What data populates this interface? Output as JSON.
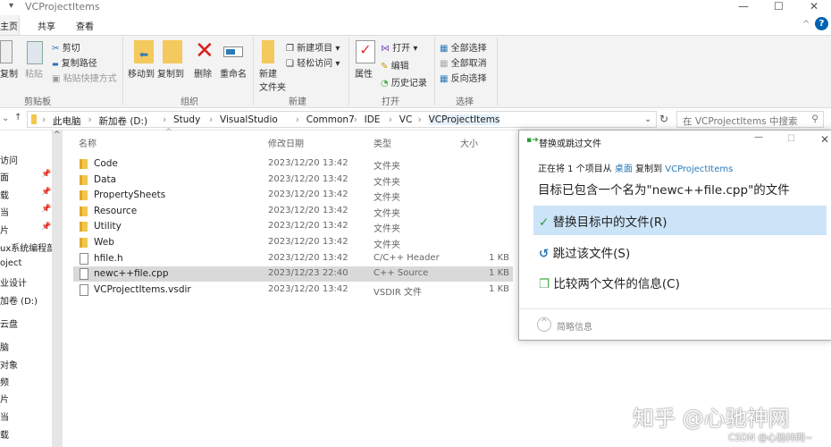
{
  "window": {
    "title": "VCProjectItems",
    "minimize": "—",
    "maximize": "☐",
    "close": "✕"
  },
  "tabs": [
    "主页",
    "共享",
    "查看"
  ],
  "ribbon": {
    "clipboard": {
      "copy": "复制",
      "paste": "粘贴",
      "cut": "剪切",
      "copy_path": "复制路径",
      "paste_shortcut": "粘贴快捷方式",
      "group": "剪贴板"
    },
    "organize": {
      "move_to": "移动到",
      "copy_to": "复制到",
      "delete": "删除",
      "rename": "重命名",
      "group": "组织"
    },
    "new": {
      "new_folder_1": "新建",
      "new_folder_2": "文件夹",
      "new_item": "新建项目",
      "easy_access": "轻松访问",
      "group": "新建"
    },
    "open": {
      "properties": "属性",
      "open": "打开",
      "edit": "编辑",
      "history": "历史记录",
      "group": "打开"
    },
    "select": {
      "select_all": "全部选择",
      "select_none": "全部取消",
      "invert": "反向选择",
      "group": "选择"
    }
  },
  "address": {
    "crumbs": [
      "此电脑",
      "新加卷 (D:)",
      "Study",
      "VisualStudio",
      "Common7",
      "IDE",
      "VC",
      "VCProjectItems"
    ],
    "search_placeholder": "在 VCProjectItems 中搜索"
  },
  "sidebar": [
    "访问",
    "面",
    "载",
    "当",
    "片",
    "ux系统编程部",
    "oject",
    "业设计",
    "加卷 (D:)",
    "云盘",
    "脑",
    "对象",
    "频",
    "片",
    "当",
    "载"
  ],
  "columns": {
    "name": "名称",
    "date": "修改日期",
    "type": "类型",
    "size": "大小"
  },
  "files": [
    {
      "name": "Code",
      "date": "2023/12/20 13:42",
      "type": "文件夹",
      "size": "",
      "kind": "folder"
    },
    {
      "name": "Data",
      "date": "2023/12/20 13:42",
      "type": "文件夹",
      "size": "",
      "kind": "folder"
    },
    {
      "name": "PropertySheets",
      "date": "2023/12/20 13:42",
      "type": "文件夹",
      "size": "",
      "kind": "folder"
    },
    {
      "name": "Resource",
      "date": "2023/12/20 13:42",
      "type": "文件夹",
      "size": "",
      "kind": "folder"
    },
    {
      "name": "Utility",
      "date": "2023/12/20 13:42",
      "type": "文件夹",
      "size": "",
      "kind": "folder"
    },
    {
      "name": "Web",
      "date": "2023/12/20 13:42",
      "type": "文件夹",
      "size": "",
      "kind": "folder"
    },
    {
      "name": "hfile.h",
      "date": "2023/12/20 13:42",
      "type": "C/C++ Header",
      "size": "1 KB",
      "kind": "file"
    },
    {
      "name": "newc++file.cpp",
      "date": "2023/12/23 22:40",
      "type": "C++ Source",
      "size": "1 KB",
      "kind": "file"
    },
    {
      "name": "VCProjectItems.vsdir",
      "date": "2023/12/20 13:42",
      "type": "VSDIR 文件",
      "size": "1 KB",
      "kind": "file"
    }
  ],
  "dialog": {
    "title": "替换或跳过文件",
    "copy_prefix": "正在将 1 个项目从",
    "source": "桌面",
    "copy_mid": "复制到",
    "dest": "VCProjectItems",
    "message": "目标已包含一个名为\"newc++file.cpp\"的文件",
    "replace": "替换目标中的文件(R)",
    "skip": "跳过该文件(S)",
    "compare": "比较两个文件的信息(C)",
    "details": "简略信息"
  },
  "watermark": {
    "zhihu": "知乎 @心驰神网",
    "csdn": "CSDN @心驰神网~"
  },
  "colors": {
    "accent": "#0063b1",
    "highlight": "#cce4f7",
    "link": "#2a7ab8"
  }
}
